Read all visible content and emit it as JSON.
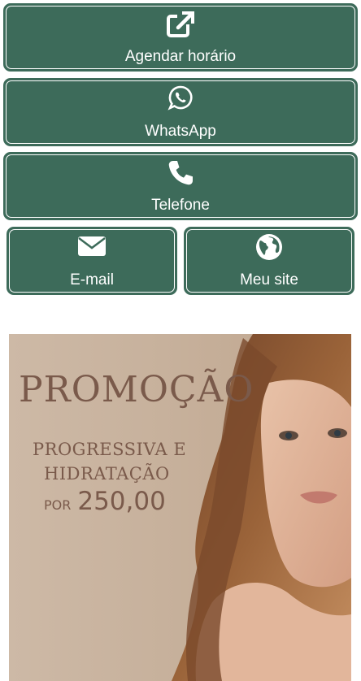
{
  "theme": {
    "button_color": "#3d6b5a",
    "promo_text_color": "#7a5a4b"
  },
  "buttons": {
    "agendar": {
      "label": "Agendar horário",
      "icon": "external-link-icon"
    },
    "whatsapp": {
      "label": "WhatsApp",
      "icon": "whatsapp-icon"
    },
    "telefone": {
      "label": "Telefone",
      "icon": "phone-icon"
    },
    "email": {
      "label": "E-mail",
      "icon": "envelope-icon"
    },
    "site": {
      "label": "Meu site",
      "icon": "globe-icon"
    }
  },
  "promo": {
    "title": "PROMOÇÃO",
    "line1": "PROGRESSIVA E",
    "line2": "HIDRATAÇÃO",
    "price_prefix": "POR",
    "price": "250,00"
  }
}
